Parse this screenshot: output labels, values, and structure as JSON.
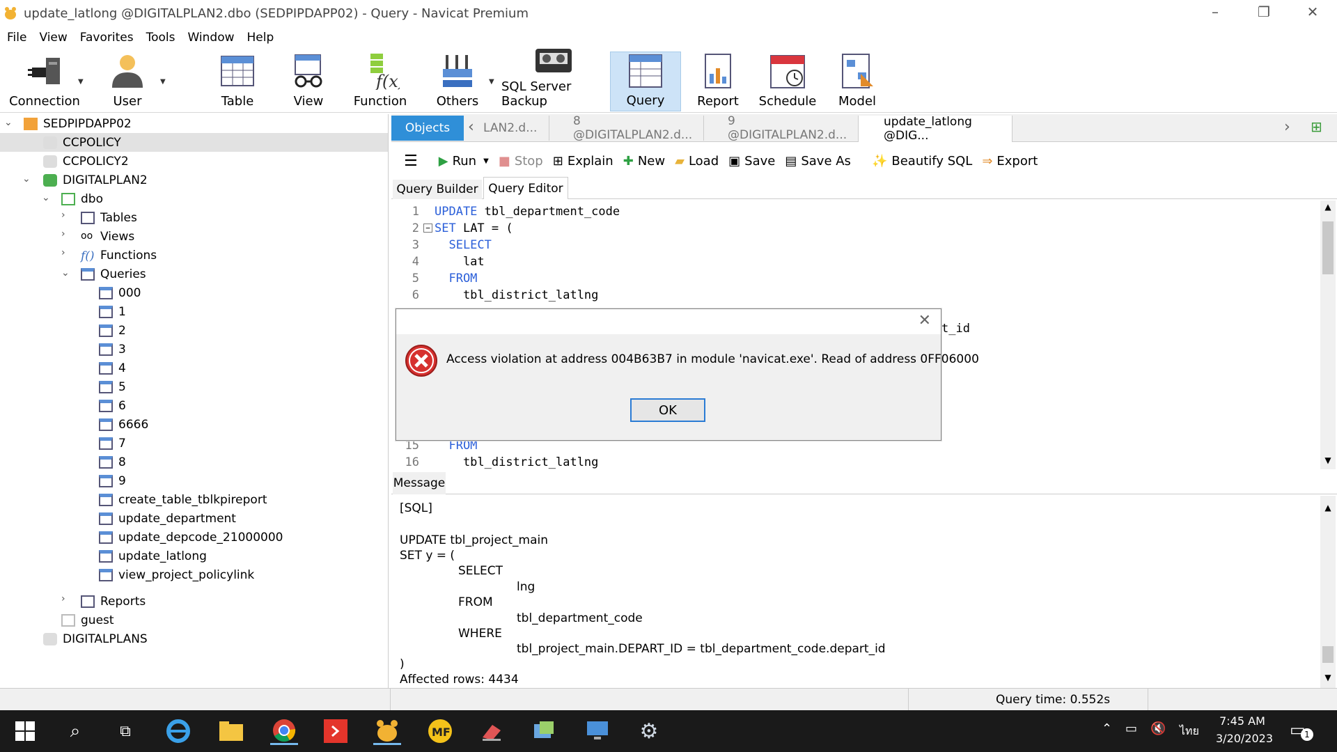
{
  "window": {
    "title": "update_latlong @DIGITALPLAN2.dbo (SEDPIPDAPP02) - Query - Navicat Premium"
  },
  "menu": [
    "File",
    "View",
    "Favorites",
    "Tools",
    "Window",
    "Help"
  ],
  "toolbar": {
    "connection": "Connection",
    "user": "User",
    "table": "Table",
    "view": "View",
    "function": "Function",
    "others": "Others",
    "backup": "SQL Server Backup",
    "query": "Query",
    "report": "Report",
    "schedule": "Schedule",
    "model": "Model"
  },
  "tree": {
    "server": "SEDPIPDAPP02",
    "db1": "CCPOLICY",
    "db2": "CCPOLICY2",
    "db3": "DIGITALPLAN2",
    "schema": "dbo",
    "tables": "Tables",
    "views": "Views",
    "functions": "Functions",
    "queries": "Queries",
    "query_items": [
      "000",
      "1",
      "2",
      "3",
      "4",
      "5",
      "6",
      "6666",
      "7",
      "8",
      "9",
      "create_table_tblkpireport",
      "update_department",
      "update_depcode_21000000",
      "update_latlong",
      "view_project_policylink"
    ],
    "reports": "Reports",
    "guest": "guest",
    "db4": "DIGITALPLANS"
  },
  "tabs": {
    "objects": "Objects",
    "t1": "LAN2.d...",
    "t2": "8 @DIGITALPLAN2.d...",
    "t3": "9 @DIGITALPLAN2.d...",
    "t4": "update_latlong @DIG..."
  },
  "qtoolbar": {
    "run": "Run",
    "stop": "Stop",
    "explain": "Explain",
    "new": "New",
    "load": "Load",
    "save": "Save",
    "saveas": "Save As",
    "beautify": "Beautify SQL",
    "export": "Export"
  },
  "subtabs": {
    "builder": "Query Builder",
    "editor": "Query Editor"
  },
  "editor": {
    "lines": [
      {
        "n": "1",
        "k": "UPDATE",
        "t": " tbl_department_code"
      },
      {
        "n": "2",
        "k": "SET",
        "t": " LAT = ("
      },
      {
        "n": "3",
        "k": "  SELECT",
        "t": ""
      },
      {
        "n": "4",
        "k": "",
        "t": "    lat"
      },
      {
        "n": "5",
        "k": "  FROM",
        "t": ""
      },
      {
        "n": "6",
        "k": "",
        "t": "    tbl_district_latlng"
      },
      {
        "n": "15",
        "k": "  FROM",
        "t": ""
      },
      {
        "n": "16",
        "k": "",
        "t": "    tbl_district_latlng"
      }
    ],
    "partial": "t_id"
  },
  "message": {
    "tab": "Message",
    "lines": [
      "[SQL]",
      "UPDATE tbl_project_main",
      "SET y = (",
      "SELECT",
      "lng",
      "FROM",
      "tbl_department_code",
      "WHERE",
      "tbl_project_main.DEPART_ID = tbl_department_code.depart_id",
      ")",
      "Affected rows: 4434"
    ]
  },
  "status": {
    "query_time": "Query time: 0.552s"
  },
  "dialog": {
    "text": "Access violation at address 004B63B7 in module 'navicat.exe'. Read of address 0FF06000",
    "ok": "OK"
  },
  "taskbar": {
    "time": "7:45 AM",
    "date": "3/20/2023",
    "lang": "ไทย",
    "notif": "1"
  }
}
